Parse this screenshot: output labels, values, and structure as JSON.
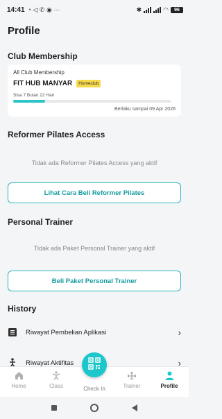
{
  "status_bar": {
    "time": "14:41",
    "battery": "96"
  },
  "page": {
    "title": "Profile"
  },
  "club_membership": {
    "title": "Club Membership",
    "card_label": "All Club Membership",
    "club_name": "FIT HUB MANYAR",
    "badge": "Homeclub",
    "remaining": "Sisa 7 Bulan 22 Hari",
    "progress_fraction": 0.2,
    "valid_until": "Berlaku sampai 09 Apr 2026"
  },
  "reformer": {
    "title": "Reformer Pilates Access",
    "empty": "Tidak ada Reformer Pilates Access yang aktif",
    "button": "Lihat Cara Beli Reformer Pilates"
  },
  "personal_trainer": {
    "title": "Personal Trainer",
    "empty": "Tidak ada Paket Personal Trainer yang aktif",
    "button": "Beli Paket Personal Trainer"
  },
  "history": {
    "title": "History",
    "items": [
      {
        "label": "Riwayat Pembelian Aplikasi",
        "icon": "list-icon"
      },
      {
        "label": "Riwayat Aktifitas",
        "icon": "activity-icon"
      }
    ]
  },
  "navbar": {
    "items": [
      {
        "label": "Home",
        "icon": "home-icon"
      },
      {
        "label": "Class",
        "icon": "class-icon"
      },
      {
        "label": "Check In",
        "icon": "qr-icon"
      },
      {
        "label": "Trainer",
        "icon": "trainer-icon"
      },
      {
        "label": "Profile",
        "icon": "profile-icon"
      }
    ]
  },
  "colors": {
    "accent": "#2bc4c9",
    "badge": "#f6d84b"
  }
}
